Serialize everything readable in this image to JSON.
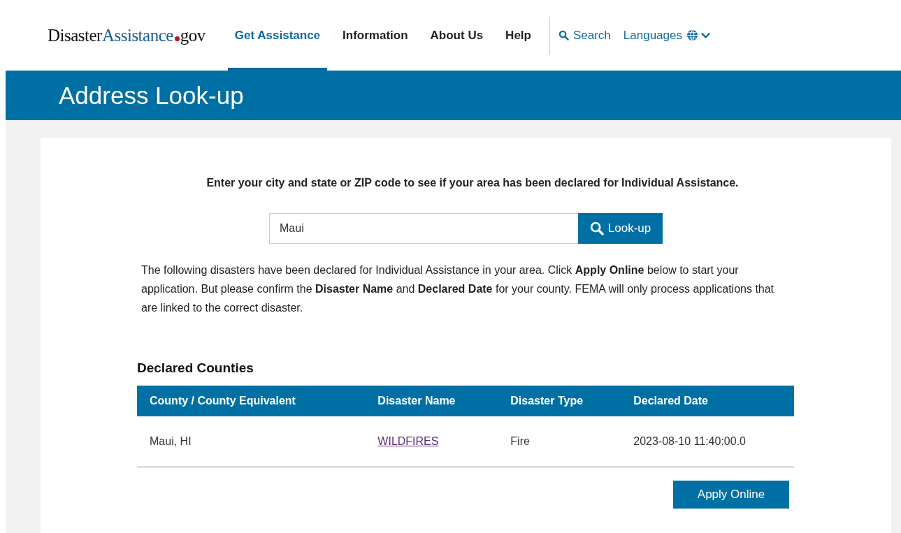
{
  "header": {
    "logo": {
      "parts": [
        "Disaster",
        "Assistance",
        "gov"
      ]
    },
    "nav": [
      {
        "label": "Get Assistance",
        "selected": true
      },
      {
        "label": "Information",
        "selected": false
      },
      {
        "label": "About Us",
        "selected": false
      },
      {
        "label": "Help",
        "selected": false
      }
    ],
    "search_link": "Search",
    "languages_link": "Languages"
  },
  "banner": {
    "title": "Address Look-up"
  },
  "lookup": {
    "instruction": "Enter your city and state or ZIP code to see if your area has been declared for Individual Assistance.",
    "value": "Maui",
    "button": "Look-up"
  },
  "notice": "The following disasters have been declared for Individual Assistance in your area. Click **Apply Online** below to start your application. But please confirm the **Disaster Name** and **Declared Date** for your county. FEMA will only process applications that are linked to the correct disaster.",
  "table": {
    "title": "Declared Counties",
    "columns": [
      "County / County Equivalent",
      "Disaster Name",
      "Disaster Type",
      "Declared Date"
    ],
    "rows": [
      [
        "Maui, HI",
        "WILDFIRES",
        "Fire",
        "2023-08-10 11:40:00.0"
      ]
    ]
  },
  "apply_button": "Apply Online"
}
